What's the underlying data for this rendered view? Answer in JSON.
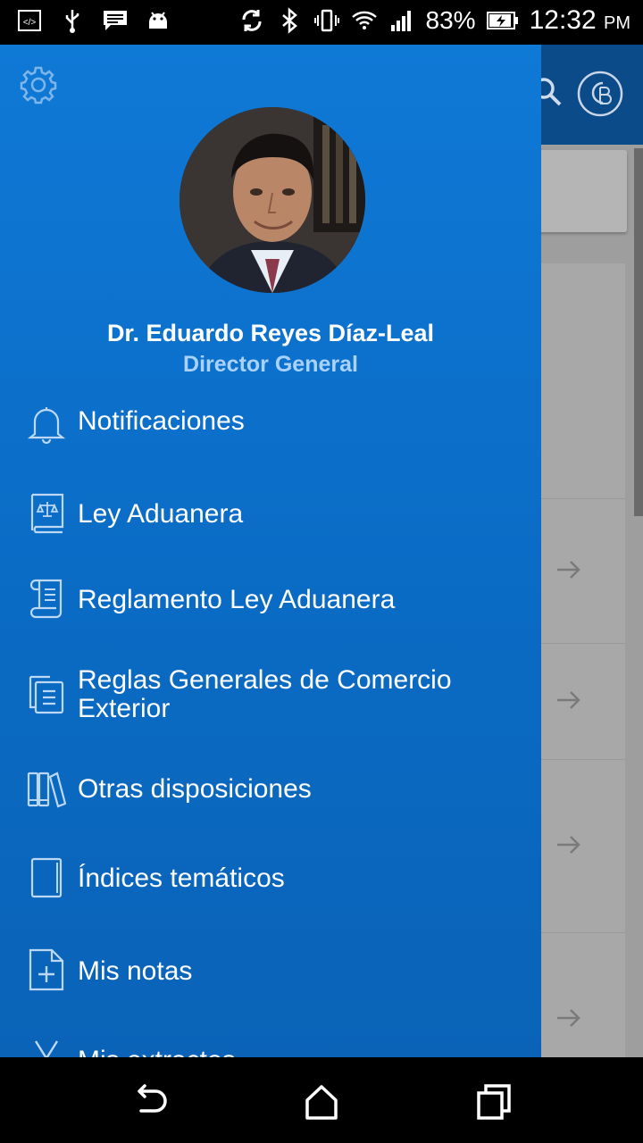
{
  "status_bar": {
    "battery_percent": "83%",
    "time": "12:32",
    "ampm": "PM"
  },
  "drawer": {
    "user": {
      "name": "Dr. Eduardo Reyes Díaz-Leal",
      "role": "Director General"
    },
    "items": [
      {
        "label": "Notificaciones",
        "icon": "bell-icon"
      },
      {
        "label": "Ley Aduanera",
        "icon": "law-book-icon"
      },
      {
        "label": "Reglamento Ley Aduanera",
        "icon": "scroll-icon"
      },
      {
        "label": "Reglas Generales de Comercio Exterior",
        "icon": "documents-icon"
      },
      {
        "label": "Otras disposiciones",
        "icon": "books-icon"
      },
      {
        "label": "Índices temáticos",
        "icon": "notebook-icon"
      },
      {
        "label": "Mis notas",
        "icon": "add-note-icon"
      },
      {
        "label": "Mis extractos",
        "icon": "scissors-icon"
      }
    ]
  },
  "colors": {
    "drawer_background": "#0f79d6",
    "role_text": "#a9d2ff",
    "icon_stroke": "#bcd8f5"
  }
}
